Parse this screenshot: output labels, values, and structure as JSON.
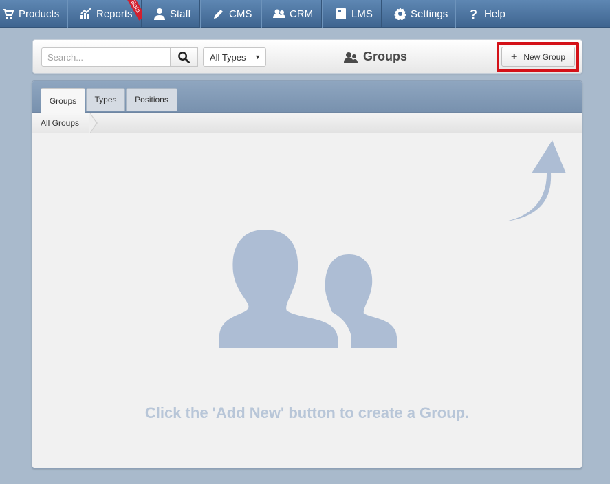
{
  "nav": {
    "items": [
      {
        "label": "Products",
        "icon": "cart-icon"
      },
      {
        "label": "Reports",
        "icon": "chart-icon",
        "badge": "Beta"
      },
      {
        "label": "Staff",
        "icon": "person-icon"
      },
      {
        "label": "CMS",
        "icon": "pencil-icon"
      },
      {
        "label": "CRM",
        "icon": "people-icon"
      },
      {
        "label": "LMS",
        "icon": "book-icon"
      },
      {
        "label": "Settings",
        "icon": "gear-icon"
      },
      {
        "label": "Help",
        "icon": "question-icon"
      }
    ]
  },
  "toolbar": {
    "search_placeholder": "Search...",
    "type_filter": "All Types",
    "title": "Groups",
    "new_button": "New Group"
  },
  "tabs": [
    {
      "label": "Groups",
      "active": true
    },
    {
      "label": "Types",
      "active": false
    },
    {
      "label": "Positions",
      "active": false
    }
  ],
  "breadcrumb": {
    "current": "All Groups"
  },
  "empty_state": {
    "message": "Click the 'Add New' button to create a Group."
  },
  "colors": {
    "nav_bg": "#4a72a0",
    "page_bg": "#a9bacc",
    "highlight": "#d41118",
    "placeholder_graphic": "#adbdd4",
    "beta_badge": "#d3202f"
  }
}
